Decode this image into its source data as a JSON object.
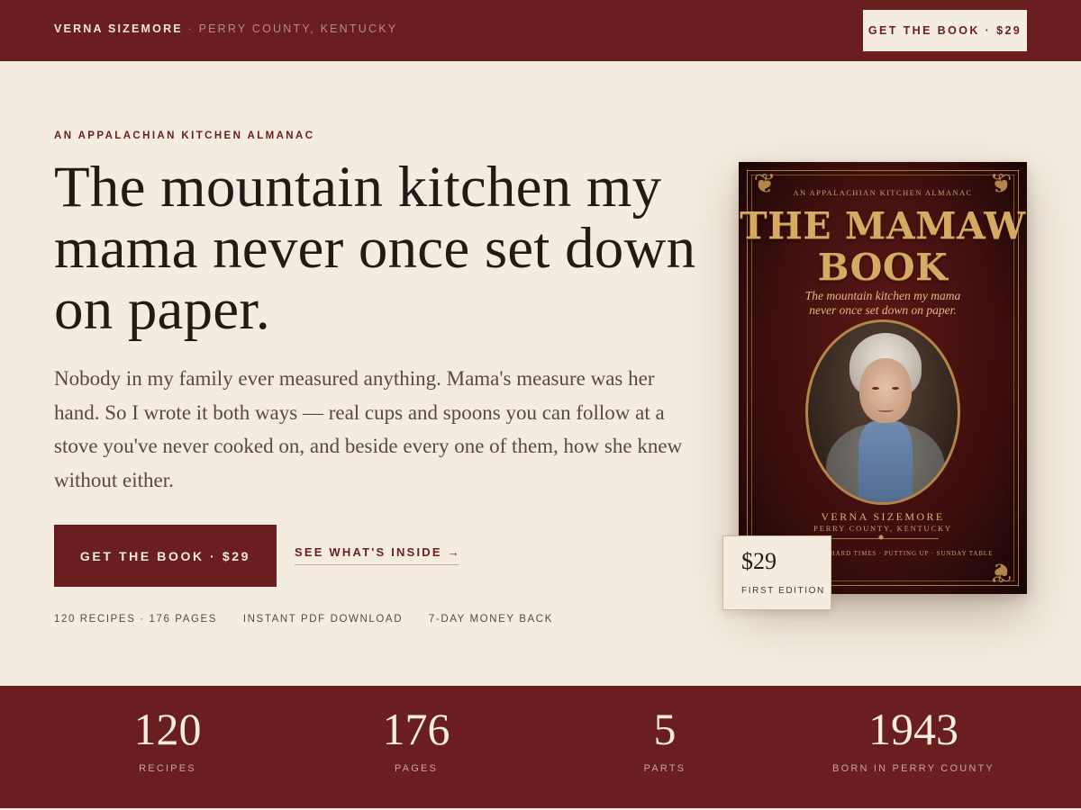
{
  "topbar": {
    "author": "VERNA SIZEMORE",
    "separator": "·",
    "place": "PERRY COUNTY, KENTUCKY",
    "cta_label": "GET THE BOOK · $29"
  },
  "hero": {
    "eyebrow": "AN APPALACHIAN KITCHEN ALMANAC",
    "headline": "The mountain kitchen my mama never once set down on paper.",
    "lede": "Nobody in my family ever measured anything. Mama's measure was her hand. So I wrote it both ways — real cups and spoons you can follow at a stove you've never cooked on, and beside every one of them, how she knew without either.",
    "primary_cta": "GET THE BOOK · $29",
    "secondary_cta": "SEE WHAT'S INSIDE",
    "secondary_cta_icon": "arrow-right-icon",
    "features": [
      "120 RECIPES · 176 PAGES",
      "INSTANT PDF DOWNLOAD",
      "7-DAY MONEY BACK"
    ]
  },
  "book_cover": {
    "eyebrow": "AN APPALACHIAN KITCHEN ALMANAC",
    "title_line1": "THE MAMAW",
    "title_line2": "BOOK",
    "subtitle_line1": "The mountain kitchen my mama",
    "subtitle_line2": "never once set down on paper.",
    "author": "VERNA SIZEMORE",
    "place": "PERRY COUNTY, KENTUCKY",
    "footer": "HARD TIMES · PUTTING UP · SUNDAY TABLE"
  },
  "price_tag": {
    "amount": "$29",
    "edition": "FIRST EDITION"
  },
  "stats": [
    {
      "value": "120",
      "label": "RECIPES"
    },
    {
      "value": "176",
      "label": "PAGES"
    },
    {
      "value": "5",
      "label": "PARTS"
    },
    {
      "value": "1943",
      "label": "BORN IN PERRY COUNTY"
    }
  ],
  "colors": {
    "brand_red": "#6b1e1f",
    "cream": "#f4ece0",
    "ink": "#231a15",
    "gold": "#d6aa62"
  }
}
